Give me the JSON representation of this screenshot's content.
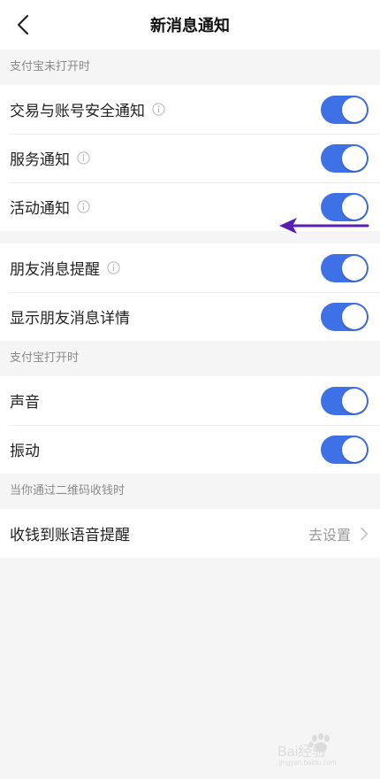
{
  "header": {
    "title": "新消息通知",
    "back_icon": "chevron-left-icon"
  },
  "sections": {
    "closed": {
      "label": "支付宝未打开时",
      "items": [
        {
          "label": "交易与账号安全通知",
          "info": true,
          "toggle": true
        },
        {
          "label": "服务通知",
          "info": true,
          "toggle": true
        },
        {
          "label": "活动通知",
          "info": true,
          "toggle": true
        }
      ]
    },
    "friends": {
      "items": [
        {
          "label": "朋友消息提醒",
          "info": true,
          "toggle": true
        },
        {
          "label": "显示朋友消息详情",
          "info": false,
          "toggle": true
        }
      ]
    },
    "open": {
      "label": "支付宝打开时",
      "items": [
        {
          "label": "声音",
          "toggle": true
        },
        {
          "label": "振动",
          "toggle": true
        }
      ]
    },
    "qr": {
      "label": "当你通过二维码收钱时",
      "items": [
        {
          "label": "收钱到账语音提醒",
          "value": "去设置"
        }
      ]
    }
  },
  "colors": {
    "toggle_on": "#3f71e6",
    "arrow": "#5a1fb0",
    "background": "#f5f5f5"
  },
  "watermark": {
    "text": "Bai经验",
    "sub": "jingyan.baidu.com"
  }
}
